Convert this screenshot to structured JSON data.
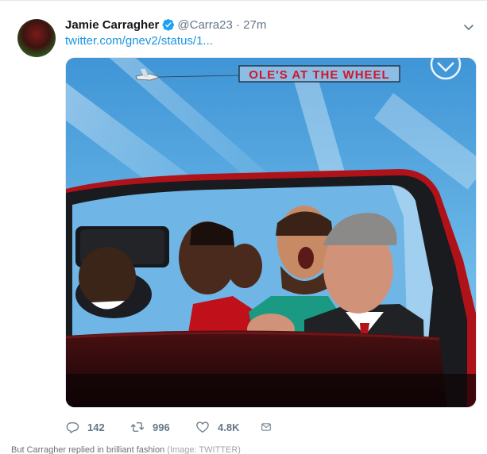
{
  "tweet": {
    "author_name": "Jamie Carragher",
    "handle": "@Carra23",
    "separator": "·",
    "time": "27m",
    "link_text": "twitter.com/gnev2/status/1...",
    "media": {
      "banner_text": "OLE'S AT THE WHEEL",
      "icon": "manchester-united-crest-icon"
    },
    "actions": {
      "replies": "142",
      "retweets": "996",
      "likes": "4.8K"
    }
  },
  "caption": {
    "text": "But Carragher replied in brilliant fashion",
    "credit": "(Image: TWITTER)"
  },
  "colors": {
    "link": "#1b95e0",
    "verified": "#1da1f2",
    "muted": "#657786",
    "sky": "#4a9fd8",
    "car_red": "#c8141b"
  }
}
